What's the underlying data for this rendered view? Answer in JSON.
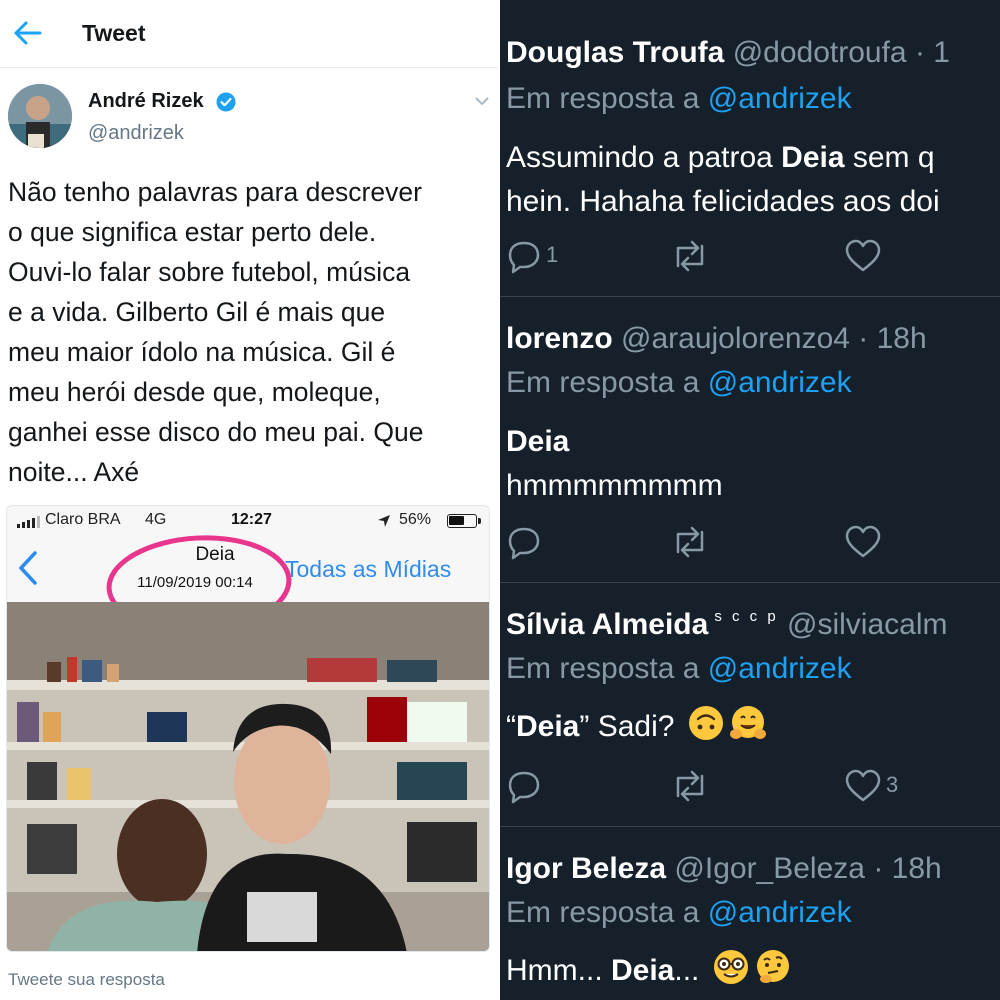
{
  "left": {
    "header_title": "Tweet",
    "author": {
      "name": "André Rizek",
      "handle": "@andrizek"
    },
    "tweet_lines": [
      "Não tenho palavras para descrever",
      "o que significa estar perto dele.",
      "Ouvi-lo falar sobre futebol, música",
      "e a vida. Gilberto Gil é mais que",
      "meu maior ídolo na música. Gil é",
      "meu herói desde que, moleque,",
      "ganhei esse disco do meu pai. Que",
      "noite... Axé"
    ],
    "phone": {
      "carrier": "Claro BRA",
      "network": "4G",
      "time": "12:27",
      "battery": "56%",
      "battery_level": 0.56,
      "contact": "Deia",
      "date": "11/09/2019 00:14",
      "all_media": "Todas as Mídias"
    },
    "reply_placeholder": "Tweete sua resposta"
  },
  "replies": [
    {
      "name": "Douglas Troufa",
      "handle": "@dodotroufa",
      "time": "· 1",
      "in_reply_prefix": "Em resposta a",
      "in_reply_to": "@andrizek",
      "lines": [
        {
          "pre": "Assumindo a patroa ",
          "bold": "Deia",
          "post": " sem q"
        },
        {
          "pre": "hein. Hahaha felicidades aos doi",
          "bold": "",
          "post": ""
        }
      ],
      "reply_count": "1",
      "like_count": ""
    },
    {
      "name": "lorenzo",
      "handle": "@araujolorenzo4",
      "time": "· 18h",
      "in_reply_prefix": "Em resposta a",
      "in_reply_to": "@andrizek",
      "lines": [
        {
          "pre": "",
          "bold": "Deia",
          "post": ""
        },
        {
          "pre": "hmmmmmmmm",
          "bold": "",
          "post": ""
        }
      ],
      "reply_count": "",
      "like_count": ""
    },
    {
      "name": "Sílvia Almeida",
      "badge": "s c c p",
      "handle": "@silviacalm",
      "time": "",
      "in_reply_prefix": "Em resposta a",
      "in_reply_to": "@andrizek",
      "lines": [
        {
          "pre": "“",
          "bold": "Deia",
          "post": "” Sadi?"
        }
      ],
      "emojis": [
        "upside-down-face-emoji",
        "hugging-face-emoji"
      ],
      "reply_count": "",
      "like_count": "3"
    },
    {
      "name": "Igor Beleza",
      "handle": "@Igor_Beleza",
      "time": "· 18h",
      "in_reply_prefix": "Em resposta a",
      "in_reply_to": "@andrizek",
      "lines": [
        {
          "pre": "Hmm... ",
          "bold": "Deia",
          "post": "..."
        }
      ],
      "emojis": [
        "nerd-face-emoji",
        "thinking-face-emoji"
      ]
    }
  ],
  "colors": {
    "twitter_blue": "#1da1f2",
    "dark_bg": "#15202b",
    "dark_muted": "#8899a6",
    "ios_blue": "#2e8cf0",
    "highlight_pink": "#e8368f"
  }
}
